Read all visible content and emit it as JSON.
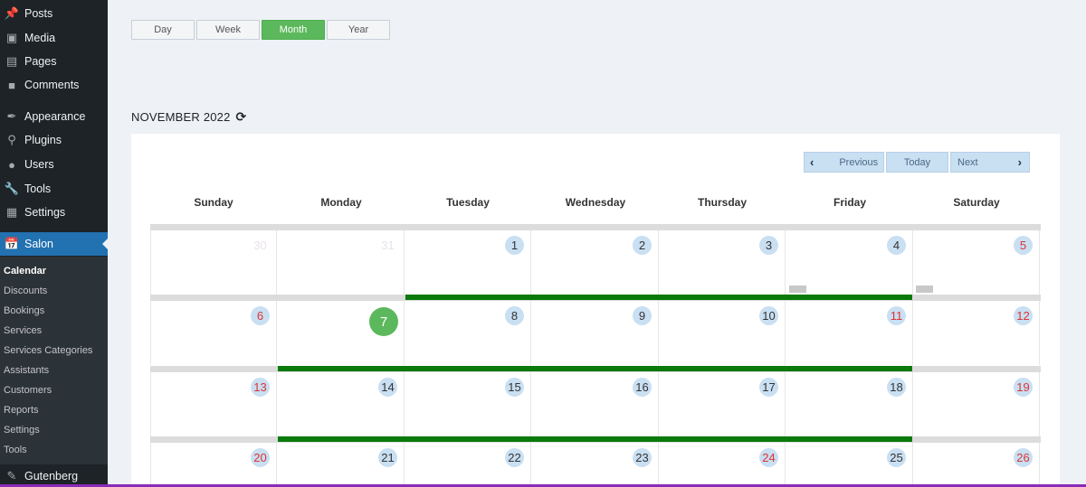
{
  "sidebar": {
    "items": [
      {
        "label": "Posts",
        "icon": "pushpin-icon"
      },
      {
        "label": "Media",
        "icon": "media-icon"
      },
      {
        "label": "Pages",
        "icon": "pages-icon"
      },
      {
        "label": "Comments",
        "icon": "comment-icon"
      },
      {
        "label": "Appearance",
        "icon": "brush-icon"
      },
      {
        "label": "Plugins",
        "icon": "plugin-icon"
      },
      {
        "label": "Users",
        "icon": "user-icon"
      },
      {
        "label": "Tools",
        "icon": "wrench-icon"
      },
      {
        "label": "Settings",
        "icon": "settings-icon"
      },
      {
        "label": "Salon",
        "icon": "calendar-icon"
      }
    ],
    "submenu": [
      "Calendar",
      "Discounts",
      "Bookings",
      "Services",
      "Services Categories",
      "Assistants",
      "Customers",
      "Reports",
      "Settings",
      "Tools"
    ],
    "footer_item": {
      "label": "Gutenberg",
      "icon": "pencil-icon"
    }
  },
  "views": {
    "day": "Day",
    "week": "Week",
    "month": "Month",
    "year": "Year",
    "active": "Month"
  },
  "calendar": {
    "title": "NOVEMBER 2022",
    "nav": {
      "previous": "Previous",
      "today": "Today",
      "next": "Next"
    },
    "weekdays": [
      "Sunday",
      "Monday",
      "Tuesday",
      "Wednesday",
      "Thursday",
      "Friday",
      "Saturday"
    ],
    "weeks": [
      [
        "30",
        "31",
        "1",
        "2",
        "3",
        "4",
        "5"
      ],
      [
        "6",
        "7",
        "8",
        "9",
        "10",
        "11",
        "12"
      ],
      [
        "13",
        "14",
        "15",
        "16",
        "17",
        "18",
        "19"
      ],
      [
        "20",
        "21",
        "22",
        "23",
        "24",
        "25",
        "26"
      ]
    ],
    "today": "7"
  },
  "colors": {
    "accent": "#5cb85c",
    "sidebar_bg": "#1d2327",
    "active_menu": "#2271b1",
    "day_badge": "#c9dff2",
    "weekend_text": "#dd3333",
    "availability_bar": "#0a7a0a"
  }
}
